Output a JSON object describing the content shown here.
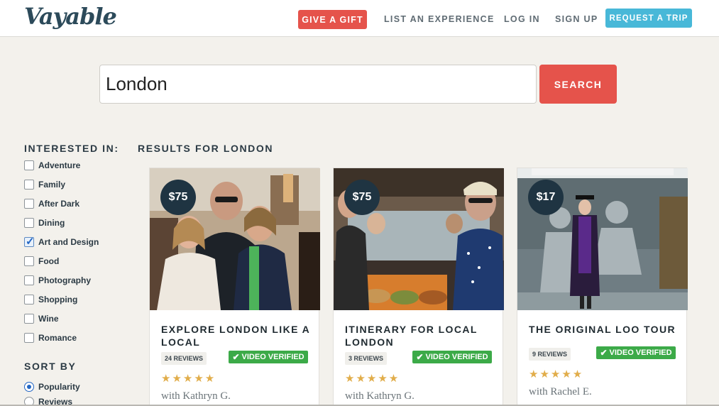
{
  "header": {
    "logo": "Vayable",
    "give_gift": "GIVE A GIFT",
    "list_experience": "LIST AN EXPERIENCE",
    "log_in": "LOG IN",
    "sign_up": "SIGN UP",
    "request_trip": "REQUEST A TRIP"
  },
  "search": {
    "value": "London",
    "button": "SEARCH"
  },
  "sidebar": {
    "interested_heading": "INTERESTED IN:",
    "filters": [
      {
        "label": "Adventure",
        "checked": false
      },
      {
        "label": "Family",
        "checked": false
      },
      {
        "label": "After Dark",
        "checked": false
      },
      {
        "label": "Dining",
        "checked": false
      },
      {
        "label": "Art and Design",
        "checked": true
      },
      {
        "label": "Food",
        "checked": false
      },
      {
        "label": "Photography",
        "checked": false
      },
      {
        "label": "Shopping",
        "checked": false
      },
      {
        "label": "Wine",
        "checked": false
      },
      {
        "label": "Romance",
        "checked": false
      }
    ],
    "sort_heading": "SORT BY",
    "sort_options": [
      {
        "label": "Popularity",
        "checked": true
      },
      {
        "label": "Reviews",
        "checked": false
      }
    ]
  },
  "results": {
    "heading": "RESULTS FOR LONDON",
    "cards": [
      {
        "price": "$75",
        "title": "EXPLORE LONDON LIKE A LOCAL",
        "reviews": "24 REVIEWS",
        "video": "VIDEO VERIFIED",
        "stars": "★★★★★",
        "rating": 5,
        "host": "with Kathryn G."
      },
      {
        "price": "$75",
        "title": "ITINERARY FOR LOCAL LONDON",
        "reviews": "3 REVIEWS",
        "video": "VIDEO VERIFIED",
        "stars": "★★★★★",
        "rating": 5,
        "host": "with Kathryn G."
      },
      {
        "price": "$17",
        "title": "THE ORIGINAL LOO TOUR",
        "reviews": "9 REVIEWS",
        "video": "VIDEO VERIFIED",
        "stars": "★★★★★",
        "rating": 5,
        "host": "with Rachel E."
      }
    ]
  },
  "colors": {
    "brand_red": "#e5534b",
    "brand_blue": "#48b8d8",
    "verified_green": "#3caa48",
    "star_gold": "#e1ad4a",
    "badge_navy": "#1f3442"
  },
  "icons": {
    "verified": "check-icon",
    "rating": "star-icon"
  }
}
